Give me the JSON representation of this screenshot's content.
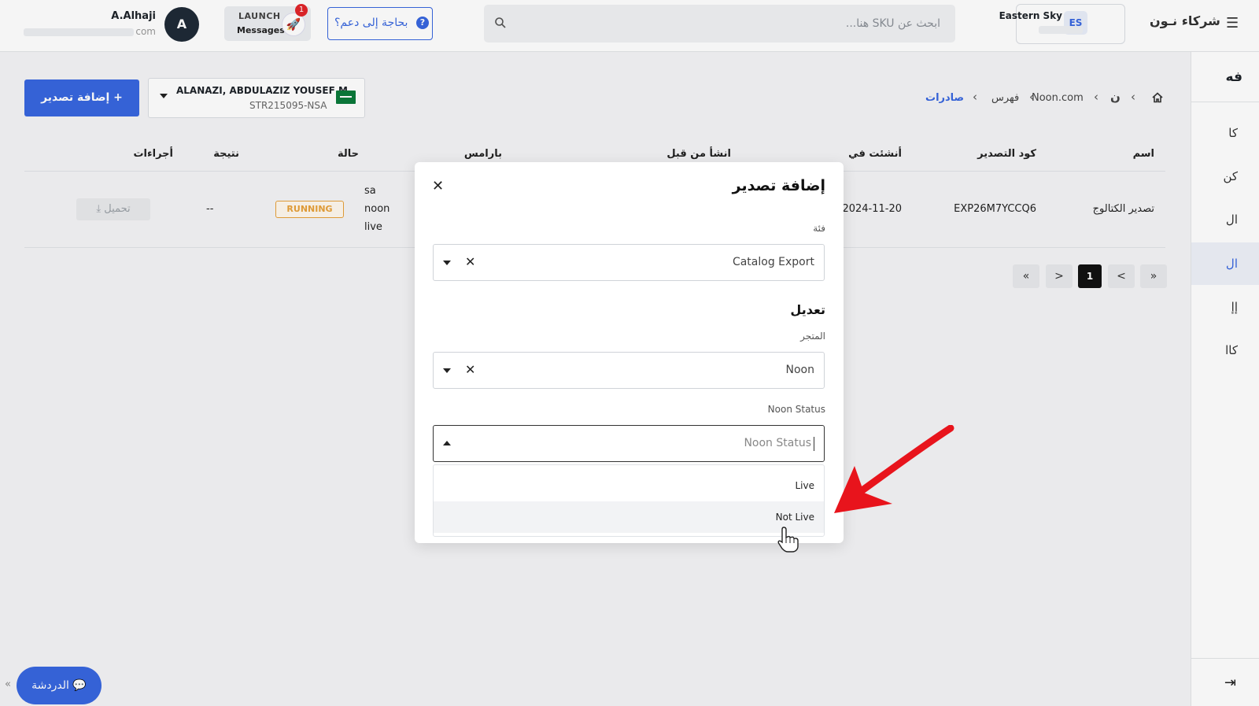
{
  "topbar": {
    "brand": "شركاء نـون",
    "store_badge": "ES",
    "store_name": "Eastern Sky",
    "search_placeholder": "ابحث عن SKU هنا...",
    "support_label": "بحاجة إلى دعم؟",
    "support_icon": "?",
    "launch_label": "LAUNCH",
    "messages_label": "Messages",
    "launch_badge": "1",
    "avatar_letter": "A",
    "user_name": "A.Alhaji",
    "user_email_suffix": "com"
  },
  "sidebar": {
    "top": "فه",
    "items": [
      "كا",
      "كن",
      "ال",
      "ال",
      "إإ",
      "كاا"
    ],
    "active_index": 3,
    "collapse_icon": "⇥"
  },
  "page": {
    "add_export_label": "+ إضافة تصدير",
    "seller_name": "ALANAZI, ABDULAZIZ YOUSEF M",
    "seller_code": "STR215095-NSA",
    "breadcrumb": {
      "home": "home-icon",
      "noon": "ن",
      "site": "Noon.com",
      "catalog": "فهرس",
      "exports": "صادرات"
    }
  },
  "table": {
    "headers": {
      "name": "اسم",
      "code": "كود التصدير",
      "created_at": "أنشئت في",
      "created_by": "انشأ من قبل",
      "params": "بارامس",
      "status": "حالة",
      "result": "نتيجة",
      "actions": "أجراءات"
    },
    "rows": [
      {
        "name": "تصدير الكتالوج",
        "code": "EXP26M7YCCQ6",
        "created_at": "2024-11-20",
        "params": [
          "sa",
          "noon",
          "live"
        ],
        "status": "RUNNING",
        "result": "--",
        "action": "⤓ تحميل"
      }
    ]
  },
  "pagination": {
    "first": "«",
    "prev": "<",
    "current": "1",
    "next": ">",
    "last": "»"
  },
  "chat": {
    "label": "الدردشة",
    "collapse": "«"
  },
  "modal": {
    "title": "إضافة تصدير",
    "category_label": "فئة",
    "category_value": "Catalog Export",
    "section_title": "تعديل",
    "store_label": "المتجر",
    "store_value": "Noon",
    "noon_status_label": "Noon Status",
    "noon_status_placeholder": "Noon Status",
    "options": [
      "Live",
      "Not Live"
    ],
    "hovered_option": "Not Live"
  },
  "colors": {
    "primary": "#3866df",
    "running": "#e8a13a",
    "annotation_arrow": "#e8141c",
    "badge_red": "#e1252a"
  }
}
